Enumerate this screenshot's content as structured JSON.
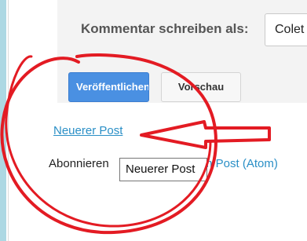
{
  "comment_form": {
    "label": "Kommentar schreiben als:",
    "identity_value": "Colet",
    "publish_label": "Veröffentlichen",
    "preview_label": "Vorschau"
  },
  "post_nav": {
    "newer_post": "Neuerer Post"
  },
  "subscribe": {
    "prefix": "Abonnieren",
    "link": "m Post (Atom)"
  },
  "tooltip": {
    "text": "Neuerer Post"
  },
  "annotation": {
    "color": "#e31b23",
    "shapes": [
      "circle",
      "arrow"
    ]
  }
}
